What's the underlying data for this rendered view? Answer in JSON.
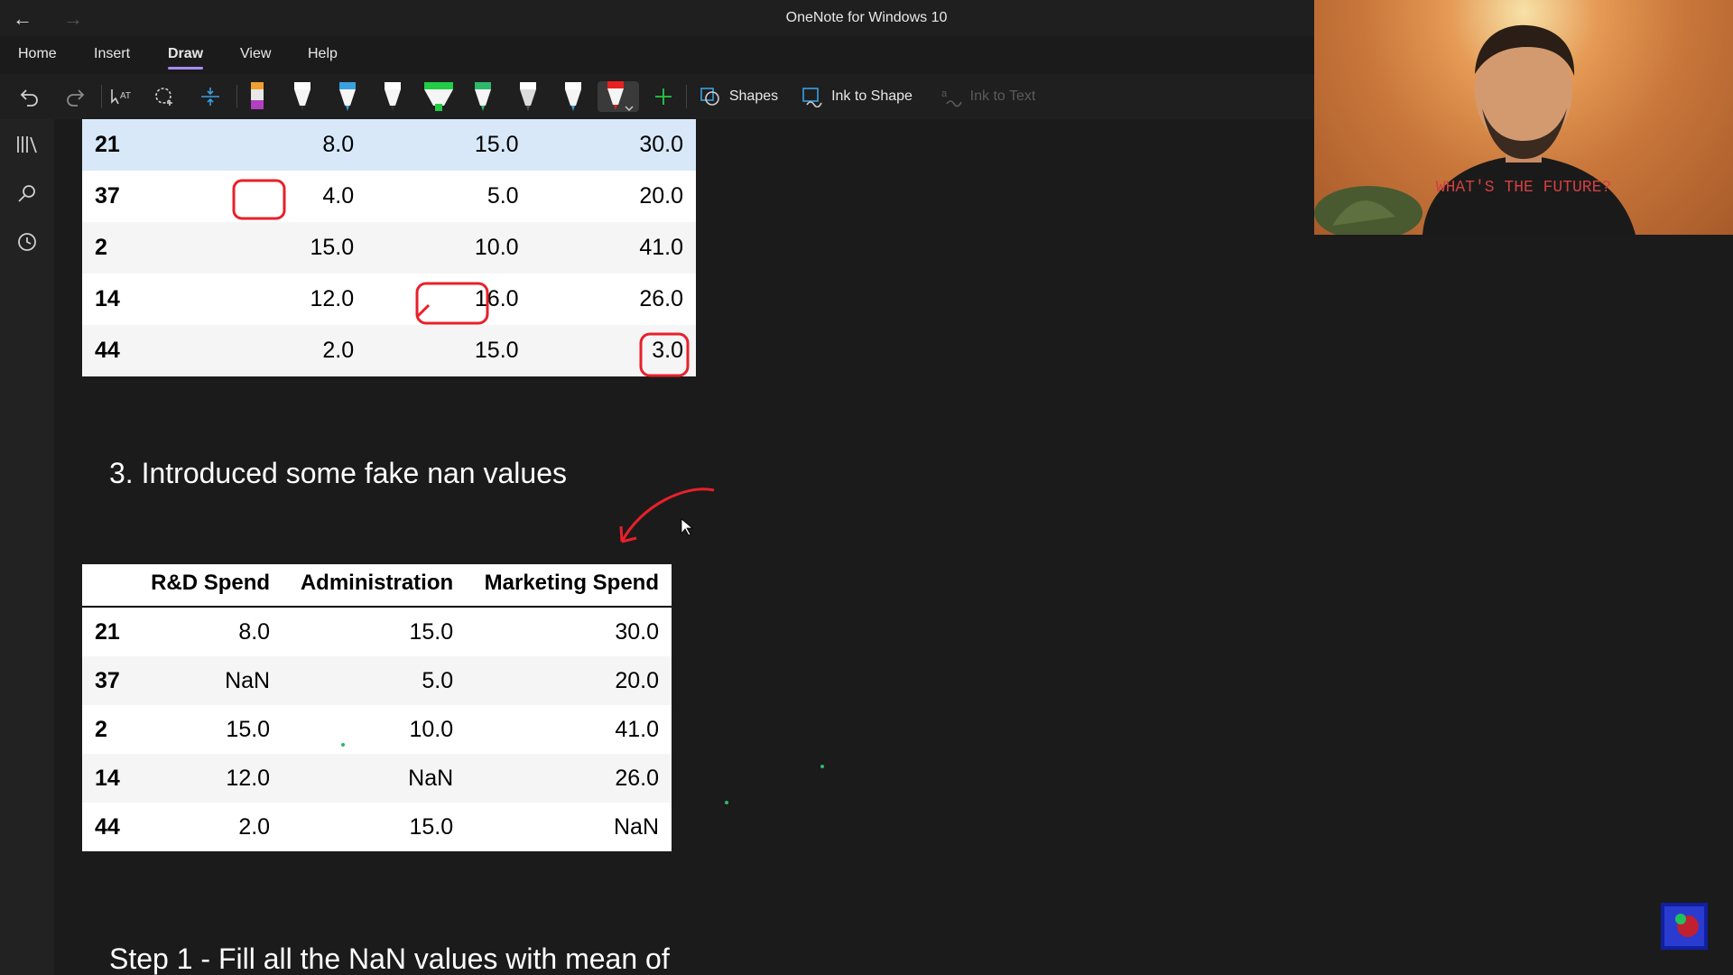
{
  "app": {
    "title": "OneNote for Windows 10"
  },
  "tabs": [
    "Home",
    "Insert",
    "Draw",
    "View",
    "Help"
  ],
  "active_tab": "Draw",
  "toolbar": {
    "shapes_label": "Shapes",
    "ink_to_shape_label": "Ink to Shape",
    "ink_to_text_label": "Ink to Text",
    "pen_colors": [
      "#f0a030",
      "#ffffff",
      "#3aa0e0",
      "#ffffff",
      "#22cc44",
      "#2db86c",
      "#ffffff",
      "#ffffff",
      "#e82020"
    ]
  },
  "left_rail": {
    "icons": [
      "notebooks-icon",
      "search-icon",
      "recent-icon"
    ]
  },
  "table1": {
    "rows": [
      {
        "idx": "21",
        "c1": "8.0",
        "c2": "15.0",
        "c3": "30.0"
      },
      {
        "idx": "37",
        "c1": "4.0",
        "c2": "5.0",
        "c3": "20.0"
      },
      {
        "idx": "2",
        "c1": "15.0",
        "c2": "10.0",
        "c3": "41.0"
      },
      {
        "idx": "14",
        "c1": "12.0",
        "c2": "16.0",
        "c3": "26.0"
      },
      {
        "idx": "44",
        "c1": "2.0",
        "c2": "15.0",
        "c3": "3.0"
      }
    ]
  },
  "section": {
    "heading": "3.  Introduced some fake nan values"
  },
  "table2": {
    "columns": [
      "",
      "R&D Spend",
      "Administration",
      "Marketing Spend"
    ],
    "rows": [
      {
        "idx": "21",
        "c1": "8.0",
        "c2": "15.0",
        "c3": "30.0"
      },
      {
        "idx": "37",
        "c1": "NaN",
        "c2": "5.0",
        "c3": "20.0"
      },
      {
        "idx": "2",
        "c1": "15.0",
        "c2": "10.0",
        "c3": "41.0"
      },
      {
        "idx": "14",
        "c1": "12.0",
        "c2": "NaN",
        "c3": "26.0"
      },
      {
        "idx": "44",
        "c1": "2.0",
        "c2": "15.0",
        "c3": "NaN"
      }
    ]
  },
  "step_text": "Step 1 - Fill all the NaN values with mean of",
  "webcam": {
    "shirt_text": "WHAT'S THE FUTURE?"
  },
  "colors": {
    "ink": "#e8202a",
    "accent": "#a78bfa",
    "highlight_row": "#d8e8f8"
  }
}
